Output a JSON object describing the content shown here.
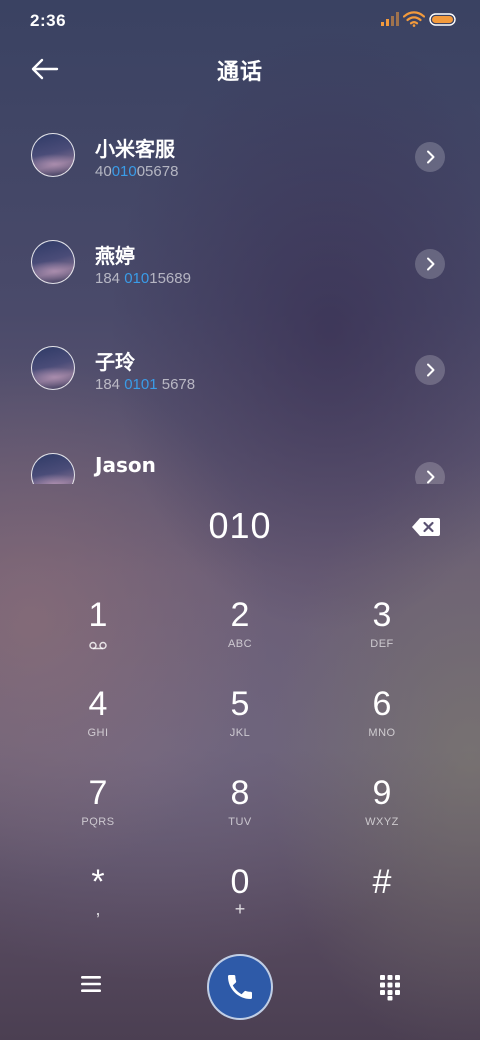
{
  "status_bar": {
    "time": "2:36",
    "icons": [
      "signal-icon",
      "wifi-icon",
      "battery-icon"
    ],
    "accent_color": "#f39a3c"
  },
  "header": {
    "title": "通话",
    "back_icon": "back-arrow-icon"
  },
  "contacts": [
    {
      "name": "小米客服",
      "number_pre": "40",
      "number_match": "010",
      "number_post": "05678"
    },
    {
      "name": "燕婷",
      "number_pre": "184 ",
      "number_match": "010",
      "number_post": "15689"
    },
    {
      "name": "子玲",
      "number_pre": "184 ",
      "number_match": "0101",
      "number_post": " 5678"
    },
    {
      "name": "Jason",
      "number_pre": "",
      "number_match": "",
      "number_post": ""
    }
  ],
  "highlight_color": "#3a9ce8",
  "dialer": {
    "number": "010",
    "delete_icon": "backspace-icon"
  },
  "keypad": {
    "keys": [
      {
        "digit": "1",
        "letters": "",
        "icon": "voicemail-icon"
      },
      {
        "digit": "2",
        "letters": "ABC"
      },
      {
        "digit": "3",
        "letters": "DEF"
      },
      {
        "digit": "4",
        "letters": "GHI"
      },
      {
        "digit": "5",
        "letters": "JKL"
      },
      {
        "digit": "6",
        "letters": "MNO"
      },
      {
        "digit": "7",
        "letters": "PQRS"
      },
      {
        "digit": "8",
        "letters": "TUV"
      },
      {
        "digit": "9",
        "letters": "WXYZ"
      },
      {
        "digit": "*",
        "sub": ","
      },
      {
        "digit": "0",
        "sub": "+"
      },
      {
        "digit": "#",
        "sub": ""
      }
    ]
  },
  "bottom_bar": {
    "menu_icon": "menu-icon",
    "call_icon": "phone-icon",
    "call_color": "#2e5aa8",
    "keypad_icon": "dialpad-icon"
  }
}
